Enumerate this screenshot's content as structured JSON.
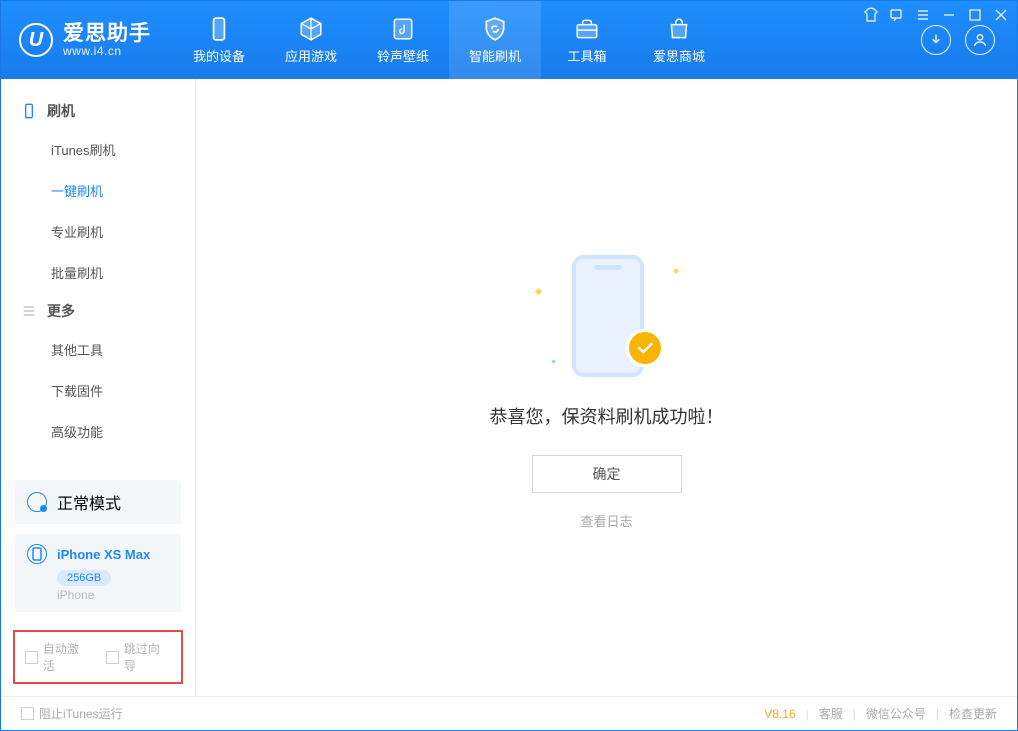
{
  "brand": {
    "name": "爱思助手",
    "url": "www.i4.cn"
  },
  "nav": [
    {
      "label": "我的设备"
    },
    {
      "label": "应用游戏"
    },
    {
      "label": "铃声壁纸"
    },
    {
      "label": "智能刷机",
      "active": true
    },
    {
      "label": "工具箱"
    },
    {
      "label": "爱思商城"
    }
  ],
  "sidebar": {
    "group1_title": "刷机",
    "group1": [
      {
        "label": "iTunes刷机"
      },
      {
        "label": "一键刷机",
        "active": true
      },
      {
        "label": "专业刷机"
      },
      {
        "label": "批量刷机"
      }
    ],
    "group2_title": "更多",
    "group2": [
      {
        "label": "其他工具"
      },
      {
        "label": "下载固件"
      },
      {
        "label": "高级功能"
      }
    ],
    "mode_label": "正常模式",
    "device": {
      "name": "iPhone XS Max",
      "storage": "256GB",
      "type": "iPhone"
    },
    "opt_auto_activate": "自动激活",
    "opt_skip_guide": "跳过向导"
  },
  "main": {
    "success_msg": "恭喜您，保资料刷机成功啦！",
    "ok_label": "确定",
    "log_link": "查看日志"
  },
  "footer": {
    "block_itunes": "阻止iTunes运行",
    "version": "V8.16",
    "links": {
      "service": "客服",
      "wechat": "微信公众号",
      "update": "检查更新"
    }
  }
}
